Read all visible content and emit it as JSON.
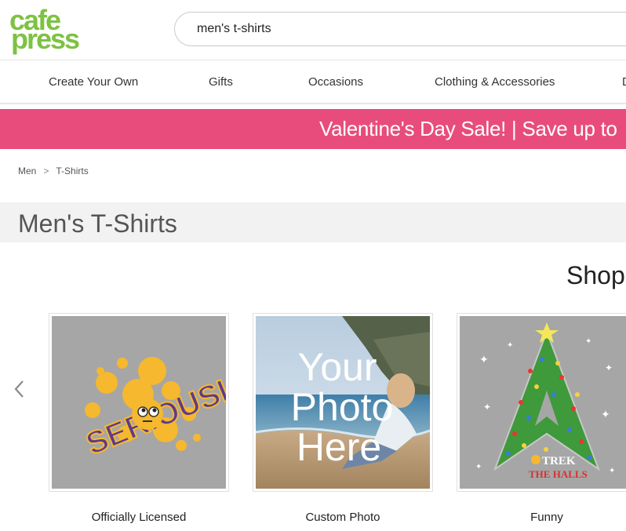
{
  "header": {
    "logo_line1": "cafe",
    "logo_line2": "press",
    "search_value": "men's t-shirts"
  },
  "nav": {
    "items": [
      {
        "label": "Create Your Own"
      },
      {
        "label": "Gifts"
      },
      {
        "label": "Occasions"
      },
      {
        "label": "Clothing & Accessories"
      },
      {
        "label": "D"
      }
    ]
  },
  "promo": {
    "text": "Valentine's Day Sale! | Save up to"
  },
  "breadcrumb": {
    "items": [
      "Men",
      "T-Shirts"
    ],
    "separator": ">"
  },
  "page": {
    "title": "Men's T-Shirts",
    "shop_heading": "Shop"
  },
  "carousel": {
    "prev_icon": "chevron-left-icon",
    "cards": [
      {
        "label": "Officially Licensed",
        "art_text": "SERIOUSLY"
      },
      {
        "label": "Custom Photo",
        "art_text": [
          "Your",
          "Photo",
          "Here"
        ]
      },
      {
        "label": "Funny",
        "art_text": [
          "TREK",
          "THE HALLS"
        ]
      }
    ]
  },
  "colors": {
    "brand_green": "#7dc242",
    "promo_pink": "#e84c7d",
    "shirt_gray": "#a6a6a6"
  }
}
